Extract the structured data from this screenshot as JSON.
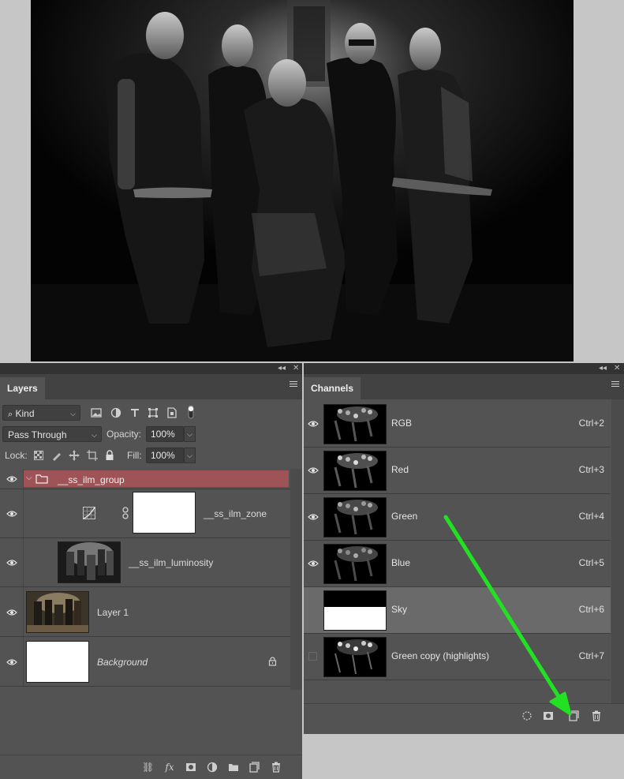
{
  "canvas": {
    "photo_label": ""
  },
  "layers_panel": {
    "tab_label": "Layers",
    "filter": {
      "kind_label": "Kind"
    },
    "blend_mode": "Pass Through",
    "opacity_label": "Opacity:",
    "opacity_value": "100%",
    "lock_label": "Lock:",
    "fill_label": "Fill:",
    "fill_value": "100%",
    "layers": [
      {
        "name": "__ss_ilm_group",
        "type": "group",
        "visible": true
      },
      {
        "name": "__ss_ilm_zone",
        "type": "adjustment",
        "visible": true
      },
      {
        "name": "__ss_ilm_luminosity",
        "type": "pixel",
        "visible": true
      },
      {
        "name": "Layer 1",
        "type": "pixel",
        "visible": true
      },
      {
        "name": "Background",
        "type": "background",
        "visible": true,
        "locked": true
      }
    ]
  },
  "channels_panel": {
    "tab_label": "Channels",
    "channels": [
      {
        "name": "RGB",
        "shortcut": "Ctrl+2",
        "visible": true,
        "selected": false
      },
      {
        "name": "Red",
        "shortcut": "Ctrl+3",
        "visible": true,
        "selected": false
      },
      {
        "name": "Green",
        "shortcut": "Ctrl+4",
        "visible": true,
        "selected": false
      },
      {
        "name": "Blue",
        "shortcut": "Ctrl+5",
        "visible": true,
        "selected": false
      },
      {
        "name": "Sky",
        "shortcut": "Ctrl+6",
        "visible": false,
        "selected": true
      },
      {
        "name": "Green copy (highlights)",
        "shortcut": "Ctrl+7",
        "visible": false,
        "selected": false
      }
    ]
  },
  "colors": {
    "panel_bg": "#535353",
    "group_row": "#9e5456",
    "selected_channel": "#6a6a6a",
    "annotation_arrow": "#22e022"
  }
}
